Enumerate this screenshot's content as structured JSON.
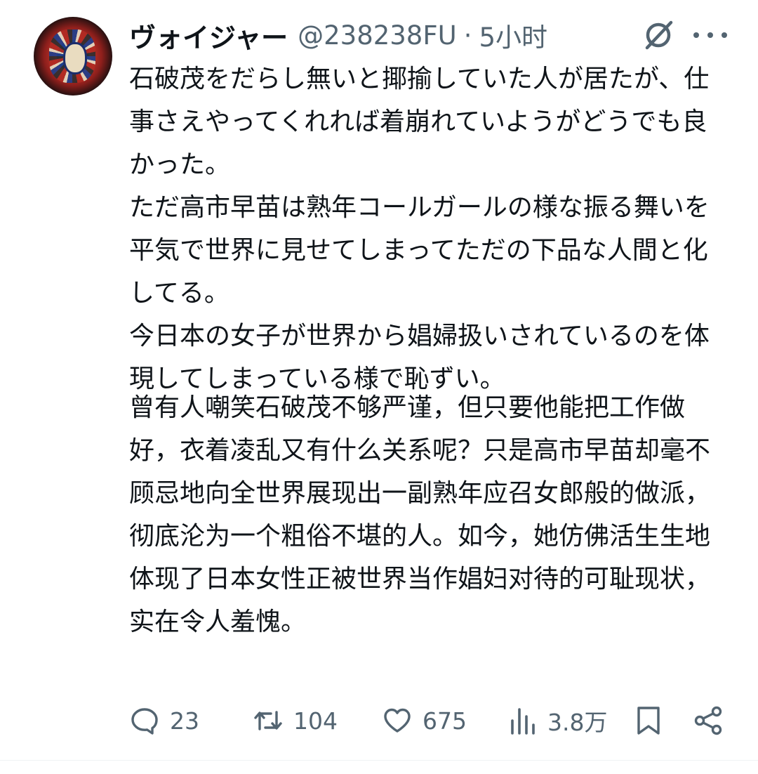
{
  "post": {
    "author_name": "ヴォイジャー",
    "author_handle": "@238238FU",
    "separator": "·",
    "time": "5小时",
    "body_original": "石破茂をだらし無いと揶揄していた人が居たが、仕事さえやってくれれば着崩れていようがどうでも良かった。\nただ高市早苗は熟年コールガールの様な振る舞いを平気で世界に見せてしまってただの下品な人間と化してる。\n今日本の女子が世界から娼婦扱いされているのを体現してしまっている様で恥ずい。",
    "body_translation": "曾有人嘲笑石破茂不够严谨，但只要他能把工作做好，衣着凌乱又有什么关系呢？只是高市早苗却毫不顾忌地向全世界展现出一副熟年应召女郎般的做派，彻底沦为一个粗俗不堪的人。如今，她仿佛活生生地体现了日本女性正被世界当作娼妇对待的可耻现状，实在令人羞愧。"
  },
  "actions": {
    "replies": "23",
    "reposts": "104",
    "likes": "675",
    "views": "3.8万"
  },
  "icons": {
    "avatar": "avatar-image",
    "grok": "grok-icon",
    "more": "more-icon",
    "reply": "reply-icon",
    "repost": "repost-icon",
    "like": "heart-icon",
    "views": "views-icon",
    "bookmark": "bookmark-icon",
    "share": "share-icon"
  },
  "colors": {
    "text": "#0f1419",
    "secondary": "#536471"
  }
}
